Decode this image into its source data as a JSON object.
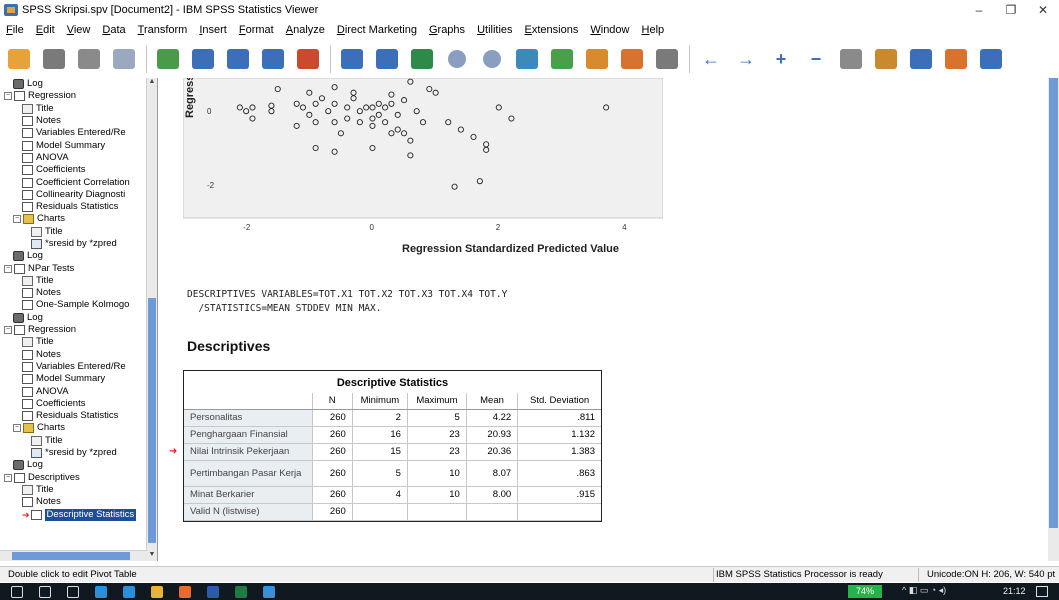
{
  "window": {
    "title": "SPSS Skripsi.spv [Document2] - IBM SPSS Statistics Viewer",
    "minimize": "–",
    "maximize": "❐",
    "close": "✕"
  },
  "menu": [
    "File",
    "Edit",
    "View",
    "Data",
    "Transform",
    "Insert",
    "Format",
    "Analyze",
    "Direct Marketing",
    "Graphs",
    "Utilities",
    "Extensions",
    "Window",
    "Help"
  ],
  "toolbar": {
    "icons": [
      "open-folder-icon",
      "save-icon",
      "print-icon",
      "print-preview-icon",
      "export-icon",
      "recall-dialog-icon",
      "undo-icon",
      "redo-icon",
      "goto-data-icon",
      "goto-case-icon",
      "variables-icon",
      "chart-builder-icon",
      "circle-icon",
      "circle-icon",
      "weight-icon",
      "select-cases-icon",
      "value-labels-icon",
      "designate-window-icon",
      "hide-icon",
      "back-arrow-icon",
      "forward-arrow-icon",
      "expand-icon",
      "collapse-icon",
      "show-icon",
      "hide-output-icon",
      "insert-heading-icon",
      "insert-title-icon",
      "insert-text-icon"
    ]
  },
  "navigator": {
    "items": [
      {
        "indent": 1,
        "icon": "log",
        "label": "Log"
      },
      {
        "indent": 0,
        "icon": "book",
        "label": "Regression",
        "pm": "−"
      },
      {
        "indent": 2,
        "icon": "title",
        "label": "Title"
      },
      {
        "indent": 2,
        "icon": "book",
        "label": "Notes"
      },
      {
        "indent": 2,
        "icon": "table",
        "label": "Variables Entered/Re"
      },
      {
        "indent": 2,
        "icon": "table",
        "label": "Model Summary"
      },
      {
        "indent": 2,
        "icon": "table",
        "label": "ANOVA"
      },
      {
        "indent": 2,
        "icon": "table",
        "label": "Coefficients"
      },
      {
        "indent": 2,
        "icon": "table",
        "label": "Coefficient Correlation"
      },
      {
        "indent": 2,
        "icon": "table",
        "label": "Collinearity Diagnosti"
      },
      {
        "indent": 2,
        "icon": "table",
        "label": "Residuals Statistics"
      },
      {
        "indent": 1,
        "icon": "folder",
        "label": "Charts",
        "pm": "−"
      },
      {
        "indent": 3,
        "icon": "title",
        "label": "Title"
      },
      {
        "indent": 3,
        "icon": "chart",
        "label": "*sresid by *zpred"
      },
      {
        "indent": 1,
        "icon": "log",
        "label": "Log"
      },
      {
        "indent": 0,
        "icon": "book",
        "label": "NPar Tests",
        "pm": "−"
      },
      {
        "indent": 2,
        "icon": "title",
        "label": "Title"
      },
      {
        "indent": 2,
        "icon": "book",
        "label": "Notes"
      },
      {
        "indent": 2,
        "icon": "table",
        "label": "One-Sample Kolmogo"
      },
      {
        "indent": 1,
        "icon": "log",
        "label": "Log"
      },
      {
        "indent": 0,
        "icon": "book",
        "label": "Regression",
        "pm": "−"
      },
      {
        "indent": 2,
        "icon": "title",
        "label": "Title"
      },
      {
        "indent": 2,
        "icon": "book",
        "label": "Notes"
      },
      {
        "indent": 2,
        "icon": "table",
        "label": "Variables Entered/Re"
      },
      {
        "indent": 2,
        "icon": "table",
        "label": "Model Summary"
      },
      {
        "indent": 2,
        "icon": "table",
        "label": "ANOVA"
      },
      {
        "indent": 2,
        "icon": "table",
        "label": "Coefficients"
      },
      {
        "indent": 2,
        "icon": "table",
        "label": "Residuals Statistics"
      },
      {
        "indent": 1,
        "icon": "folder",
        "label": "Charts",
        "pm": "−"
      },
      {
        "indent": 3,
        "icon": "title",
        "label": "Title"
      },
      {
        "indent": 3,
        "icon": "chart",
        "label": "*sresid by *zpred"
      },
      {
        "indent": 1,
        "icon": "log",
        "label": "Log"
      },
      {
        "indent": 0,
        "icon": "book",
        "label": "Descriptives",
        "pm": "−"
      },
      {
        "indent": 2,
        "icon": "title",
        "label": "Title"
      },
      {
        "indent": 2,
        "icon": "book",
        "label": "Notes"
      },
      {
        "indent": 2,
        "icon": "table",
        "label": "Descriptive Statistics",
        "selected": true,
        "arrow": true
      }
    ]
  },
  "chart_data": {
    "type": "scatter",
    "title": "",
    "xlabel": "Regression Standardized Predicted Value",
    "ylabel": "Regression Stu",
    "xlim": [
      -3.0,
      4.6
    ],
    "ylim": [
      -2.9,
      0.9
    ],
    "xticks": [
      "-2",
      "0",
      "2",
      "4"
    ],
    "xtick_values": [
      -2,
      0,
      2,
      4
    ],
    "yticks": [
      "0",
      "-2"
    ],
    "ytick_values": [
      0,
      -2
    ],
    "x": [
      -2.1,
      -2.0,
      -1.9,
      -1.9,
      -1.6,
      -1.6,
      -1.2,
      -1.2,
      -1.1,
      -1.0,
      -0.9,
      -0.9,
      -0.8,
      -0.7,
      -0.6,
      -0.6,
      -0.5,
      -0.4,
      -0.4,
      -0.3,
      -0.2,
      -0.2,
      -0.1,
      0.0,
      0.0,
      0.0,
      0.1,
      0.1,
      0.2,
      0.2,
      0.3,
      0.3,
      0.4,
      0.4,
      0.5,
      0.5,
      0.6,
      0.7,
      0.8,
      1.0,
      1.2,
      1.4,
      1.6,
      1.8,
      1.8,
      2.0,
      2.2,
      3.7,
      -1.5,
      -1.0,
      -0.6,
      -0.3,
      0.3,
      0.6,
      0.9,
      -0.9,
      -0.6,
      0.0,
      0.6,
      1.3,
      1.7
    ],
    "y": [
      0.1,
      0.0,
      0.1,
      -0.2,
      0.15,
      0.0,
      0.2,
      -0.4,
      0.1,
      -0.1,
      0.2,
      -0.3,
      0.35,
      0.0,
      -0.3,
      0.2,
      -0.6,
      0.1,
      -0.2,
      0.35,
      0.0,
      -0.3,
      0.1,
      0.1,
      -0.2,
      -0.4,
      0.2,
      -0.1,
      0.1,
      -0.3,
      0.2,
      -0.6,
      -0.1,
      -0.5,
      0.3,
      -0.6,
      -0.8,
      0.0,
      -0.3,
      0.5,
      -0.3,
      -0.5,
      -0.7,
      -1.05,
      -0.9,
      0.1,
      -0.2,
      0.1,
      0.6,
      0.5,
      0.65,
      0.5,
      0.45,
      0.8,
      0.6,
      -1.0,
      -1.1,
      -1.0,
      -1.2,
      -2.05,
      -1.9
    ]
  },
  "syntax": {
    "line1": "DESCRIPTIVES VARIABLES=TOT.X1 TOT.X2 TOT.X3 TOT.X4 TOT.Y",
    "line2": "  /STATISTICS=MEAN STDDEV MIN MAX."
  },
  "descriptives": {
    "heading": "Descriptives",
    "table_title": "Descriptive Statistics",
    "columns": [
      "N",
      "Minimum",
      "Maximum",
      "Mean",
      "Std. Deviation"
    ],
    "rows": [
      {
        "label": "Personalitas",
        "n": "260",
        "min": "2",
        "max": "5",
        "mean": "4.22",
        "sd": ".811"
      },
      {
        "label": "Penghargaan Finansial",
        "n": "260",
        "min": "16",
        "max": "23",
        "mean": "20.93",
        "sd": "1.132"
      },
      {
        "label": "Nilai Intrinsik Pekerjaan",
        "n": "260",
        "min": "15",
        "max": "23",
        "mean": "20.36",
        "sd": "1.383"
      },
      {
        "label": "Pertimbangan Pasar Kerja",
        "n": "260",
        "min": "5",
        "max": "10",
        "mean": "8.07",
        "sd": ".863"
      },
      {
        "label": "Minat Berkarier",
        "n": "260",
        "min": "4",
        "max": "10",
        "mean": "8.00",
        "sd": ".915"
      },
      {
        "label": "Valid N (listwise)",
        "n": "260",
        "min": "",
        "max": "",
        "mean": "",
        "sd": ""
      }
    ]
  },
  "status": {
    "left": "Double click to edit Pivot Table",
    "processor": "IBM SPSS Statistics Processor is ready",
    "unicode": "Unicode:ON  H: 206, W: 540 pt"
  },
  "taskbar": {
    "battery": "74%",
    "time": "21:12",
    "icons": [
      "windows-start-icon",
      "search-icon",
      "task-view-icon",
      "edge-icon",
      "store-icon",
      "file-explorer-icon",
      "firefox-icon",
      "word-icon",
      "excel-icon",
      "spss-icon"
    ]
  },
  "colors": {
    "nav_selected": "#1e4d9b",
    "scroll_thumb": "#6e9ad8",
    "red_marker": "#e02020",
    "battery": "#27b34b",
    "taskbar": "#101820",
    "chart_bg": "#f0f0f0"
  }
}
